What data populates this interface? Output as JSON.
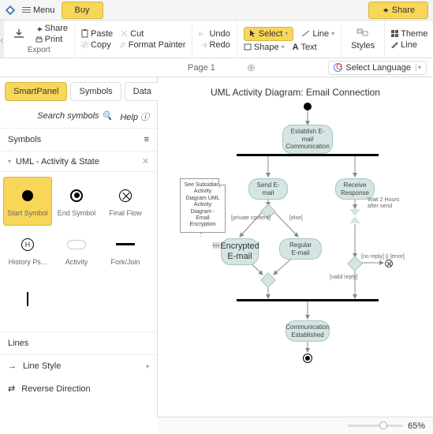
{
  "topbar": {
    "menu": "Menu",
    "buy": "Buy",
    "share": "Share"
  },
  "toolbar": {
    "export": "Export",
    "share": "Share",
    "print": "Print",
    "paste": "Paste",
    "cut": "Cut",
    "copy": "Copy",
    "fpainter": "Format Painter",
    "undo": "Undo",
    "redo": "Redo",
    "select": "Select",
    "line": "Line",
    "shape": "Shape",
    "text": "Text",
    "styles": "Styles",
    "theme": "Theme",
    "line2": "Line"
  },
  "pages": {
    "page1": "Page 1"
  },
  "lang": {
    "label": "Select Language"
  },
  "panel": {
    "tabs": {
      "smart": "SmartPanel",
      "symbols": "Symbols",
      "data": "Data"
    },
    "search": "Search symbols",
    "help": "Help",
    "symbols_hdr": "Symbols",
    "lib": "UML - Activity & State",
    "syms": {
      "start": "Start Symbol",
      "end": "End Symbol",
      "final": "Final Flow",
      "history": "History Ps...",
      "activity": "Activity",
      "fork": "Fork/Join"
    },
    "lines_hdr": "Lines",
    "line_style": "Line Style",
    "rev_dir": "Reverse Direction"
  },
  "diagram": {
    "title": "UML Activity Diagram: Email Connection",
    "nodes": {
      "establish": "Establish E-mail Communication",
      "send": "Send E-mail",
      "receive": "Receive Response",
      "encrypted": "Encrypted E-mail",
      "regular": "Regular E-mail",
      "comm_est": "Communication Established",
      "note": "See Subsidiary Activity Diagram UML Activity Diagram - Email Encryption",
      "wait": "Wait 2 Hours after send"
    },
    "labels": {
      "private": "[private content]",
      "else": "[else]",
      "noreply": "[no reply] || [error]",
      "valid": "[valid reply]"
    }
  },
  "footer": {
    "zoom": "65%"
  },
  "chart_data": {
    "type": "uml-activity",
    "title": "UML Activity Diagram: Email Connection",
    "nodes": [
      {
        "id": "start",
        "type": "initial"
      },
      {
        "id": "establish",
        "type": "activity",
        "label": "Establish E-mail Communication"
      },
      {
        "id": "fork1",
        "type": "fork"
      },
      {
        "id": "send",
        "type": "activity",
        "label": "Send E-mail"
      },
      {
        "id": "receive",
        "type": "activity",
        "label": "Receive Response"
      },
      {
        "id": "d1",
        "type": "decision"
      },
      {
        "id": "encrypted",
        "type": "activity",
        "label": "Encrypted E-mail",
        "note": "See Subsidiary Activity Diagram UML Activity Diagram - Email Encryption"
      },
      {
        "id": "regular",
        "type": "activity",
        "label": "Regular E-mail"
      },
      {
        "id": "wait",
        "type": "time-event",
        "label": "Wait 2 Hours after send"
      },
      {
        "id": "m1",
        "type": "merge"
      },
      {
        "id": "d2",
        "type": "decision"
      },
      {
        "id": "xerr",
        "type": "flow-final"
      },
      {
        "id": "join1",
        "type": "join"
      },
      {
        "id": "comm_est",
        "type": "activity",
        "label": "Communication Established"
      },
      {
        "id": "end",
        "type": "final"
      }
    ],
    "edges": [
      {
        "from": "start",
        "to": "establish"
      },
      {
        "from": "establish",
        "to": "fork1"
      },
      {
        "from": "fork1",
        "to": "send"
      },
      {
        "from": "fork1",
        "to": "receive"
      },
      {
        "from": "send",
        "to": "d1"
      },
      {
        "from": "d1",
        "to": "encrypted",
        "guard": "[private content]"
      },
      {
        "from": "d1",
        "to": "regular",
        "guard": "[else]"
      },
      {
        "from": "encrypted",
        "to": "m1"
      },
      {
        "from": "regular",
        "to": "m1"
      },
      {
        "from": "receive",
        "to": "wait"
      },
      {
        "from": "wait",
        "to": "d2"
      },
      {
        "from": "d2",
        "to": "xerr",
        "guard": "[no reply] || [error]"
      },
      {
        "from": "d2",
        "to": "join1",
        "guard": "[valid reply]"
      },
      {
        "from": "m1",
        "to": "join1"
      },
      {
        "from": "join1",
        "to": "comm_est"
      },
      {
        "from": "comm_est",
        "to": "end"
      }
    ]
  }
}
